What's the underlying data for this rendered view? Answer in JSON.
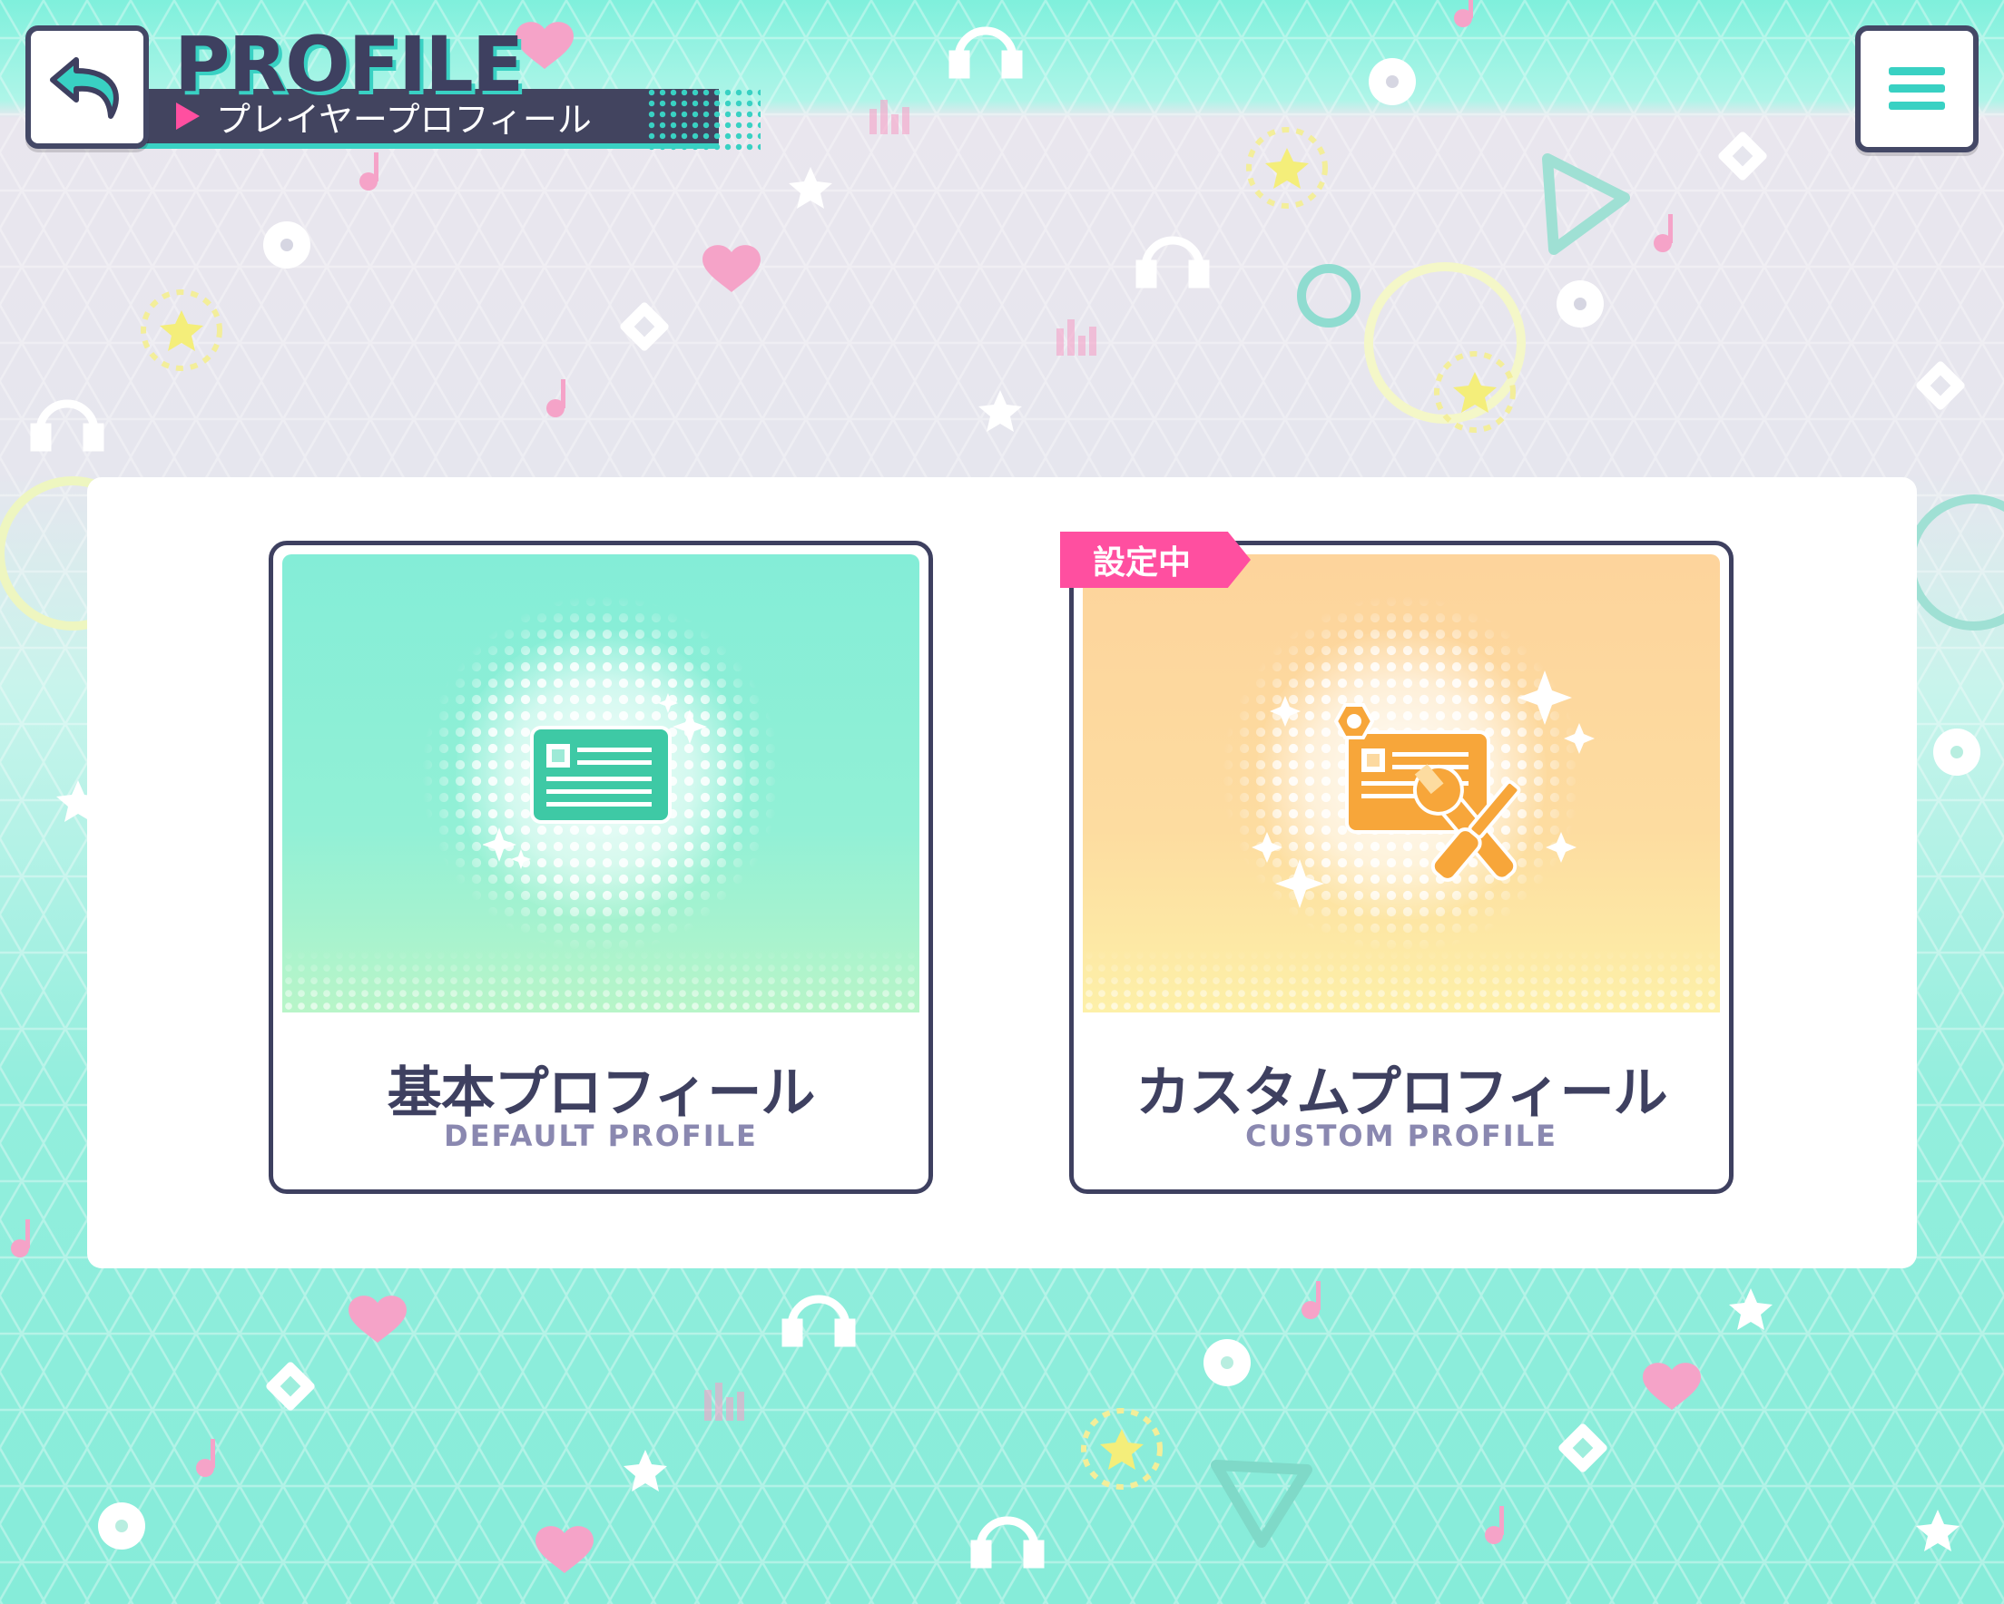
{
  "header": {
    "title": "PROFILE",
    "subtitle": "プレイヤープロフィール",
    "back_icon": "back-arrow-icon",
    "menu_icon": "hamburger-menu-icon"
  },
  "cards": [
    {
      "title": "基本プロフィール",
      "subtitle": "DEFAULT PROFILE",
      "icon": "id-card-icon",
      "active": false
    },
    {
      "title": "カスタムプロフィール",
      "subtitle": "CUSTOM PROFILE",
      "icon": "custom-card-tools-icon",
      "active": true,
      "badge": "設定中"
    }
  ],
  "colors": {
    "accent_teal": "#39d1c3",
    "accent_pink": "#ff4fa0",
    "dark_navy": "#3e4060",
    "card_default": "#86edd6",
    "card_custom": "#fdd49c",
    "icon_orange": "#f7a63a",
    "icon_teal": "#3ec9a5"
  }
}
